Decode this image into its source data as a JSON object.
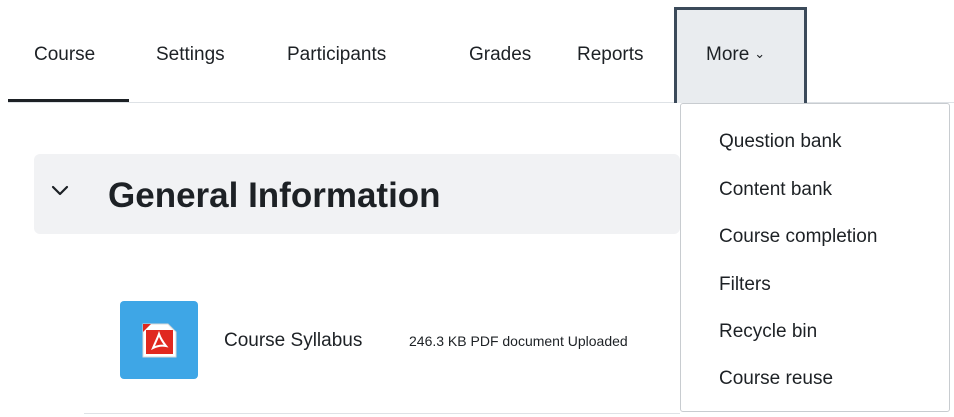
{
  "nav": {
    "tabs": [
      {
        "label": "Course"
      },
      {
        "label": "Settings"
      },
      {
        "label": "Participants"
      },
      {
        "label": "Grades"
      },
      {
        "label": "Reports"
      }
    ],
    "more_label": "More",
    "more_chevron": "⌄"
  },
  "dropdown": {
    "items": [
      {
        "label": "Question bank"
      },
      {
        "label": "Content bank"
      },
      {
        "label": "Course completion"
      },
      {
        "label": "Filters"
      },
      {
        "label": "Recycle bin"
      },
      {
        "label": "Course reuse"
      }
    ]
  },
  "section": {
    "title": "General Information"
  },
  "activity": {
    "name": "Course Syllabus",
    "meta": "246.3 KB PDF document Uploaded",
    "icon": "pdf-icon",
    "icon_bg": "#3ea6e6"
  },
  "colors": {
    "active_tab_bar": "#1d2125",
    "more_border": "#3b4a5a",
    "section_bg": "#f1f2f4"
  }
}
